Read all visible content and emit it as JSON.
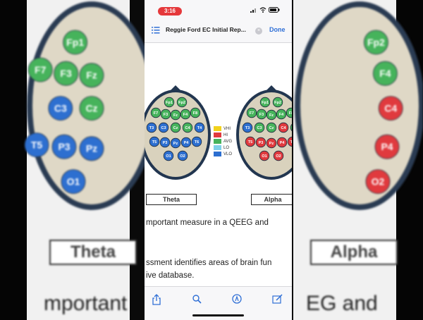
{
  "background": {
    "left_label": "Theta",
    "right_label": "Alpha",
    "left_text": "mportant",
    "right_text": "EG and",
    "left_electrodes": [
      "Fp1",
      "F7",
      "F3",
      "Fz",
      "C3",
      "Cz",
      "T5",
      "P3",
      "Pz",
      "O1"
    ],
    "right_electrodes": [
      "Fp2",
      "F4",
      "C4",
      "P4",
      "O2"
    ]
  },
  "status_bar": {
    "time": "3:16"
  },
  "nav": {
    "title": "Reggie Ford EC Initial Rep...",
    "close_glyph": "×",
    "done_label": "Done"
  },
  "document": {
    "theta_label": "Theta",
    "alpha_label": "Alpha",
    "legend": [
      {
        "label": "VHI",
        "color": "#f2d21c"
      },
      {
        "label": "HI",
        "color": "#e03a3e"
      },
      {
        "label": "AVG",
        "color": "#46b35b"
      },
      {
        "label": "LO",
        "color": "#7fd0e8"
      },
      {
        "label": "VLO",
        "color": "#2d6fd0"
      }
    ],
    "theta_electrodes": [
      {
        "name": "Fp1",
        "color": "#46b35b"
      },
      {
        "name": "Fp2",
        "color": "#46b35b"
      },
      {
        "name": "F7",
        "color": "#46b35b"
      },
      {
        "name": "F3",
        "color": "#46b35b"
      },
      {
        "name": "Fz",
        "color": "#46b35b"
      },
      {
        "name": "F4",
        "color": "#46b35b"
      },
      {
        "name": "F8",
        "color": "#46b35b"
      },
      {
        "name": "T3",
        "color": "#2d6fd0"
      },
      {
        "name": "C3",
        "color": "#2d6fd0"
      },
      {
        "name": "Cz",
        "color": "#46b35b"
      },
      {
        "name": "C4",
        "color": "#46b35b"
      },
      {
        "name": "T4",
        "color": "#2d6fd0"
      },
      {
        "name": "T5",
        "color": "#2d6fd0"
      },
      {
        "name": "P3",
        "color": "#2d6fd0"
      },
      {
        "name": "Pz",
        "color": "#2d6fd0"
      },
      {
        "name": "P4",
        "color": "#2d6fd0"
      },
      {
        "name": "T6",
        "color": "#2d6fd0"
      },
      {
        "name": "O1",
        "color": "#2d6fd0"
      },
      {
        "name": "O2",
        "color": "#2d6fd0"
      }
    ],
    "alpha_electrodes": [
      {
        "name": "Fp1",
        "color": "#46b35b"
      },
      {
        "name": "Fp2",
        "color": "#46b35b"
      },
      {
        "name": "F7",
        "color": "#46b35b"
      },
      {
        "name": "F3",
        "color": "#46b35b"
      },
      {
        "name": "Fz",
        "color": "#46b35b"
      },
      {
        "name": "F4",
        "color": "#46b35b"
      },
      {
        "name": "F8",
        "color": "#46b35b"
      },
      {
        "name": "T3",
        "color": "#2d6fd0"
      },
      {
        "name": "C3",
        "color": "#46b35b"
      },
      {
        "name": "Cz",
        "color": "#46b35b"
      },
      {
        "name": "C4",
        "color": "#e03a3e"
      },
      {
        "name": "T4",
        "color": "#46b35b"
      },
      {
        "name": "T5",
        "color": "#e03a3e"
      },
      {
        "name": "P3",
        "color": "#e03a3e"
      },
      {
        "name": "Pz",
        "color": "#e03a3e"
      },
      {
        "name": "P4",
        "color": "#e03a3e"
      },
      {
        "name": "T6",
        "color": "#e03a3e"
      },
      {
        "name": "O1",
        "color": "#e03a3e"
      },
      {
        "name": "O2",
        "color": "#e03a3e"
      }
    ],
    "paragraph_lines": [
      "mportant measure in a QEEG and",
      "ssment identifies areas of brain fun",
      "ive database."
    ]
  },
  "toolbar": {
    "icons": [
      "share-icon",
      "search-icon",
      "markup-icon",
      "edit-icon"
    ]
  }
}
